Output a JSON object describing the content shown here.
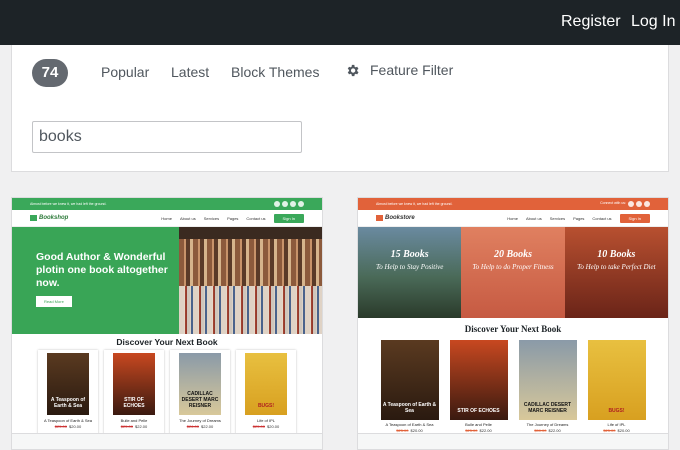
{
  "header": {
    "register": "Register",
    "login": "Log In"
  },
  "filter": {
    "count": "74",
    "tabs": [
      "Popular",
      "Latest",
      "Block Themes"
    ],
    "feature_filter": "Feature Filter",
    "search_value": "books"
  },
  "themes": [
    {
      "announce": "Almost before we knew it, we had left the ground.",
      "logo": "Bookshop",
      "menu": [
        "Home",
        "About us",
        "Services",
        "Pages",
        "Contact us"
      ],
      "signin": "Sign In",
      "hero_title": "Good Author & Wonderful plotin one book altogether now.",
      "read_more": "Read More",
      "section_title": "Discover Your Next Book",
      "books": [
        {
          "cover": "A Teaspoon of Earth & Sea",
          "title": "A Teaspoon of Earth & Sea",
          "old": "$25.00",
          "new": "$20.00"
        },
        {
          "cover": "STIR OF ECHOES",
          "title": "Bulle and Pelle",
          "old": "$25.00",
          "new": "$22.00"
        },
        {
          "cover": "CADILLAC DESERT MARC REISNER",
          "title": "The Journey of Dreams",
          "old": "$26.00",
          "new": "$22.00"
        },
        {
          "cover": "BUGS!",
          "title": "Life of IPL",
          "old": "$25.00",
          "new": "$20.00"
        }
      ]
    },
    {
      "announce": "Almost before we knew it, we had left the ground.",
      "connect": "Connect with us:",
      "logo": "Bookstore",
      "menu": [
        "Home",
        "About us",
        "Services",
        "Pages",
        "Contact us"
      ],
      "signin": "Sign In",
      "banners": [
        {
          "title": "15 Books",
          "sub": "To Help to Stay Positive"
        },
        {
          "title": "20 Books",
          "sub": "To Help to do Proper Fitness"
        },
        {
          "title": "10 Books",
          "sub": "To Help to take Perfect Diet"
        }
      ],
      "section_title": "Discover Your Next Book",
      "books": [
        {
          "cover": "A Teaspoon of Earth & Sea",
          "title": "A Teaspoon of Earth & Sea",
          "old": "$25.00",
          "new": "$20.00"
        },
        {
          "cover": "STIR OF ECHOES",
          "title": "Bulle and Pelle",
          "old": "$25.00",
          "new": "$22.00"
        },
        {
          "cover": "CADILLAC DESERT MARC REISNER",
          "title": "The Journey of Dreams",
          "old": "$50.00",
          "new": "$22.00"
        },
        {
          "cover": "BUGS!",
          "title": "Life of IPL",
          "old": "$25.00",
          "new": "$20.00"
        }
      ]
    }
  ]
}
